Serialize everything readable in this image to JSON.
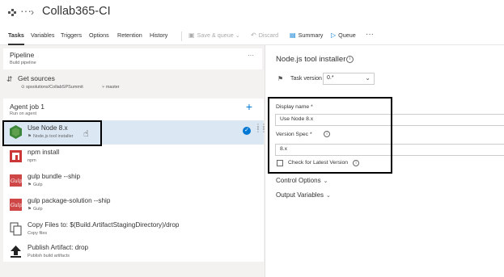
{
  "header": {
    "pipeline_name": "Collab365-CI"
  },
  "tabs": [
    {
      "label": "Tasks"
    },
    {
      "label": "Variables"
    },
    {
      "label": "Triggers"
    },
    {
      "label": "Options"
    },
    {
      "label": "Retention"
    },
    {
      "label": "History"
    }
  ],
  "toolbar": {
    "save_queue": "Save & queue",
    "discard": "Discard",
    "summary": "Summary",
    "queue": "Queue"
  },
  "pipeline": {
    "title": "Pipeline",
    "subtitle": "Build pipeline"
  },
  "sources": {
    "title": "Get sources",
    "repo": "spsolutions/CollabSPSummit",
    "branch": "master"
  },
  "job": {
    "title": "Agent job 1",
    "subtitle": "Run on agent"
  },
  "tasks": [
    {
      "name": "Use Node 8.x",
      "sub": "Node.js tool installer",
      "icon": "node-icon"
    },
    {
      "name": "npm install",
      "sub": "npm",
      "icon": "npm-icon"
    },
    {
      "name": "gulp bundle --ship",
      "sub": "Gulp",
      "icon": "gulp-icon"
    },
    {
      "name": "gulp package-solution --ship",
      "sub": "Gulp",
      "icon": "gulp-icon"
    },
    {
      "name": "Copy Files to: $(Build.ArtifactStagingDirectory)/drop",
      "sub": "Copy files",
      "icon": "copy-files-icon"
    },
    {
      "name": "Publish Artifact: drop",
      "sub": "Publish build artifacts",
      "icon": "publish-icon"
    }
  ],
  "details": {
    "title": "Node.js tool installer",
    "task_version_label": "Task version",
    "task_version_value": "0.*",
    "display_name_label": "Display name *",
    "display_name_value": "Use Node 8.x",
    "version_spec_label": "Version Spec *",
    "version_spec_value": "8.x",
    "check_latest_label": "Check for Latest Version",
    "control_options": "Control Options",
    "output_variables": "Output Variables"
  },
  "colors": {
    "accent": "#0078d4",
    "node_green": "#3c873a",
    "npm_red": "#cb3837",
    "gulp_red": "#cf4647"
  }
}
